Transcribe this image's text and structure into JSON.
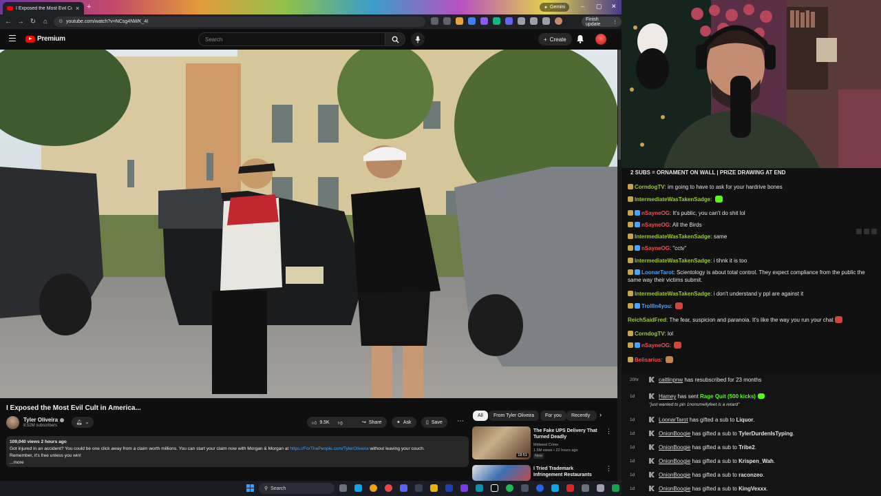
{
  "browser": {
    "tab_title": "I Exposed the Most Evil Cult in",
    "new_tab": "+",
    "gemini_label": "Gemini",
    "url": "youtube.com/watch?v=NCsg4NWK_4I",
    "finish_update": "Finish update",
    "colors": {
      "bg": "#202124",
      "omnibox": "#303134"
    }
  },
  "youtube": {
    "logo_text": "Premium",
    "search_placeholder": "Search",
    "create_label": "Create",
    "video": {
      "title": "I Exposed the Most Evil Cult in America...",
      "channel": "Tyler Oliveira",
      "subscribers": "8.52M subscribers",
      "likes": "9.5K",
      "share": "Share",
      "ask": "Ask",
      "save": "Save",
      "description": {
        "meta": "109,040 views  2 hours ago",
        "line1": "Got injured in an accident? You could be one click away from a claim worth millions. You can start your claim now with Morgan & Morgan at ",
        "link": "https://ForThePeople.com/TylerOliveira",
        "line1_end": " without leaving your couch.",
        "line2": "Remember, it's free unless you win!",
        "more": "...more"
      }
    },
    "chips": [
      "All",
      "From Tyler Oliveira",
      "For you",
      "Recently"
    ],
    "recommendations": [
      {
        "title": "The Fake UPS Delivery That Turned Deadly",
        "channel": "Midwest Crime",
        "meta": "1.5M views • 22 hours ago",
        "badge": "New",
        "duration": "18:51"
      },
      {
        "title": "I Tried Trademark Infringement Restaurants",
        "channel": "",
        "meta": "",
        "badge": "",
        "duration": ""
      }
    ],
    "colors": {
      "bg": "#0f0f0f",
      "chip": "#272727",
      "accent_red": "#ff0000",
      "link": "#3ea6ff"
    }
  },
  "stream": {
    "banner": "2 SUBS = ORNAMENT ON WALL | PRIZE DRAWING AT END",
    "chat": [
      {
        "user": "CorndogTV",
        "color": "#9acd32",
        "text": "im going to have to ask for your hardrive bones"
      },
      {
        "user": "IntermediateWasTakenSadge",
        "color": "#9acd32",
        "text": ""
      },
      {
        "user": "nSayneOG",
        "color": "#ff4b4b",
        "text": "It's public, you can't do shit lol"
      },
      {
        "user": "nSayneOG",
        "color": "#ff4b4b",
        "text": "All the Birds"
      },
      {
        "user": "IntermediateWasTakenSadge",
        "color": "#9acd32",
        "text": "same"
      },
      {
        "user": "nSayneOG",
        "color": "#ff4b4b",
        "text": "\"cctv\""
      },
      {
        "user": "IntermediateWasTakenSadge",
        "color": "#9acd32",
        "text": "i tihnk it is too"
      },
      {
        "user": "LoonarTarot",
        "color": "#4aa3ff",
        "text": "Scientology is about total control. They expect compliance from the public the same way their victims submit."
      },
      {
        "user": "IntermediateWasTakenSadge",
        "color": "#9acd32",
        "text": "i don't understand y ppl are against it"
      },
      {
        "user": "TrollIn4you",
        "color": "#4aa3ff",
        "text": ""
      },
      {
        "user": "ReichSaidFred",
        "color": "#9acd32",
        "text": "The fear, suspicion and paranoia. It's like the way you run your chat"
      },
      {
        "user": "CorndogTV",
        "color": "#9acd32",
        "text": "lol"
      },
      {
        "user": "nSayneOG",
        "color": "#ff4b4b",
        "text": ""
      },
      {
        "user": "Belisarius",
        "color": "#ff4b4b",
        "text": ""
      }
    ],
    "events": [
      {
        "age": "20hr",
        "pre": "",
        "user": "caitlinpnw",
        "text": " has resubscribed for 23 months",
        "target": "",
        "note": "",
        "rage": ""
      },
      {
        "age": "1d",
        "pre": "",
        "user": "Hamey",
        "text": " has sent ",
        "target": "",
        "note": "\"just wanted to pin 1nonsmellyfeet is a retard\"",
        "rage": "Rage Quit (500 kicks)"
      },
      {
        "age": "1d",
        "pre": "",
        "user": "LoonarTarot",
        "text": " has gifted a sub to ",
        "target": "Liquor",
        "note": "",
        "rage": ""
      },
      {
        "age": "1d",
        "pre": "",
        "user": "OnionBoogie",
        "text": " has gifted a sub to ",
        "target": "TylerDurdenIsTyping",
        "note": "",
        "rage": ""
      },
      {
        "age": "1d",
        "pre": "",
        "user": "OnionBoogie",
        "text": " has gifted a sub to ",
        "target": "Tribe2",
        "note": "",
        "rage": ""
      },
      {
        "age": "1d",
        "pre": "",
        "user": "OnionBoogie",
        "text": " has gifted a sub to ",
        "target": "Krispen_Wah",
        "note": "",
        "rage": ""
      },
      {
        "age": "1d",
        "pre": "",
        "user": "OnionBoogie",
        "text": " has gifted a sub to ",
        "target": "raconzeo",
        "note": "",
        "rage": ""
      },
      {
        "age": "1d",
        "pre": "",
        "user": "OnionBoogie",
        "text": " has gifted a sub to ",
        "target": "KingVexxx",
        "note": "",
        "rage": ""
      }
    ],
    "colors": {
      "kick_green": "#53fc18",
      "chat_bg": "#111111"
    }
  },
  "taskbar": {
    "search_label": "Search"
  }
}
